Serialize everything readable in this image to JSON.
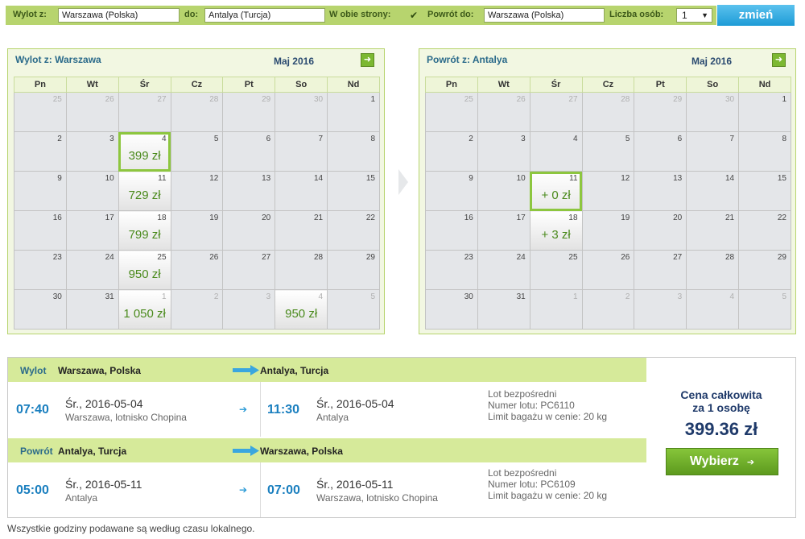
{
  "search": {
    "from_label": "Wylot z:",
    "from_value": "Warszawa (Polska)",
    "to_label": "do:",
    "to_value": "Antalya (Turcja)",
    "roundtrip_label": "W obie strony:",
    "roundtrip_checked": "✔",
    "return_label": "Powrót do:",
    "return_value": "Warszawa (Polska)",
    "pax_label": "Liczba osób:",
    "pax_value": "1",
    "change_button": "zmień"
  },
  "weekdays": [
    "Pn",
    "Wt",
    "Śr",
    "Cz",
    "Pt",
    "So",
    "Nd"
  ],
  "calendars": {
    "outbound": {
      "title_prefix": "Wylot z:",
      "title_city": "Warszawa",
      "month": "Maj 2016",
      "weeks": [
        [
          {
            "d": "25",
            "o": 1
          },
          {
            "d": "26",
            "o": 1
          },
          {
            "d": "27",
            "o": 1
          },
          {
            "d": "28",
            "o": 1
          },
          {
            "d": "29",
            "o": 1
          },
          {
            "d": "30",
            "o": 1
          },
          {
            "d": "1"
          }
        ],
        [
          {
            "d": "2"
          },
          {
            "d": "3"
          },
          {
            "d": "4",
            "p": "399 zł",
            "s": 1
          },
          {
            "d": "5"
          },
          {
            "d": "6"
          },
          {
            "d": "7"
          },
          {
            "d": "8"
          }
        ],
        [
          {
            "d": "9"
          },
          {
            "d": "10"
          },
          {
            "d": "11",
            "p": "729 zł"
          },
          {
            "d": "12"
          },
          {
            "d": "13"
          },
          {
            "d": "14"
          },
          {
            "d": "15"
          }
        ],
        [
          {
            "d": "16"
          },
          {
            "d": "17"
          },
          {
            "d": "18",
            "p": "799 zł"
          },
          {
            "d": "19"
          },
          {
            "d": "20"
          },
          {
            "d": "21"
          },
          {
            "d": "22"
          }
        ],
        [
          {
            "d": "23"
          },
          {
            "d": "24"
          },
          {
            "d": "25",
            "p": "950 zł"
          },
          {
            "d": "26"
          },
          {
            "d": "27"
          },
          {
            "d": "28"
          },
          {
            "d": "29"
          }
        ],
        [
          {
            "d": "30"
          },
          {
            "d": "31"
          },
          {
            "d": "1",
            "o": 1,
            "p": "1 050 zł"
          },
          {
            "d": "2",
            "o": 1
          },
          {
            "d": "3",
            "o": 1
          },
          {
            "d": "4",
            "o": 1,
            "p": "950 zł"
          },
          {
            "d": "5",
            "o": 1
          }
        ]
      ]
    },
    "return": {
      "title_prefix": "Powrót z:",
      "title_city": "Antalya",
      "month": "Maj 2016",
      "weeks": [
        [
          {
            "d": "25",
            "o": 1
          },
          {
            "d": "26",
            "o": 1
          },
          {
            "d": "27",
            "o": 1
          },
          {
            "d": "28",
            "o": 1
          },
          {
            "d": "29",
            "o": 1
          },
          {
            "d": "30",
            "o": 1
          },
          {
            "d": "1"
          }
        ],
        [
          {
            "d": "2"
          },
          {
            "d": "3"
          },
          {
            "d": "4"
          },
          {
            "d": "5"
          },
          {
            "d": "6"
          },
          {
            "d": "7"
          },
          {
            "d": "8"
          }
        ],
        [
          {
            "d": "9"
          },
          {
            "d": "10"
          },
          {
            "d": "11",
            "p": "+ 0 zł",
            "s": 1
          },
          {
            "d": "12"
          },
          {
            "d": "13"
          },
          {
            "d": "14"
          },
          {
            "d": "15"
          }
        ],
        [
          {
            "d": "16"
          },
          {
            "d": "17"
          },
          {
            "d": "18",
            "p": "+ 3 zł"
          },
          {
            "d": "19"
          },
          {
            "d": "20"
          },
          {
            "d": "21"
          },
          {
            "d": "22"
          }
        ],
        [
          {
            "d": "23"
          },
          {
            "d": "24"
          },
          {
            "d": "25"
          },
          {
            "d": "26"
          },
          {
            "d": "27"
          },
          {
            "d": "28"
          },
          {
            "d": "29"
          }
        ],
        [
          {
            "d": "30"
          },
          {
            "d": "31"
          },
          {
            "d": "1",
            "o": 1
          },
          {
            "d": "2",
            "o": 1
          },
          {
            "d": "3",
            "o": 1
          },
          {
            "d": "4",
            "o": 1
          },
          {
            "d": "5",
            "o": 1
          }
        ]
      ]
    }
  },
  "legs": [
    {
      "role": "Wylot",
      "from": "Warszawa, Polska",
      "to": "Antalya, Turcja",
      "dep_time": "07:40",
      "dep_date": "Śr., 2016-05-04",
      "dep_airport": "Warszawa, lotnisko Chopina",
      "arr_time": "11:30",
      "arr_date": "Śr., 2016-05-04",
      "arr_airport": "Antalya",
      "flight_type": "Lot bezpośredni",
      "flight_number": "Numer lotu: PC6110",
      "baggage": "Limit bagażu w cenie: 20 kg"
    },
    {
      "role": "Powrót",
      "from": "Antalya, Turcja",
      "to": "Warszawa, Polska",
      "dep_time": "05:00",
      "dep_date": "Śr., 2016-05-11",
      "dep_airport": "Antalya",
      "arr_time": "07:00",
      "arr_date": "Śr., 2016-05-11",
      "arr_airport": "Warszawa, lotnisko Chopina",
      "flight_type": "Lot bezpośredni",
      "flight_number": "Numer lotu: PC6109",
      "baggage": "Limit bagażu w cenie: 20 kg"
    }
  ],
  "price": {
    "line1": "Cena całkowita",
    "line2": "za 1 osobę",
    "total": "399.36 zł",
    "button": "Wybierz"
  },
  "footnote": "Wszystkie godziny podawane są według czasu lokalnego.",
  "colors": {
    "accent_green": "#8dc63f",
    "header_green": "#b7d46e",
    "link_blue": "#1a7fbf",
    "button_blue": "#1d9bd6"
  }
}
